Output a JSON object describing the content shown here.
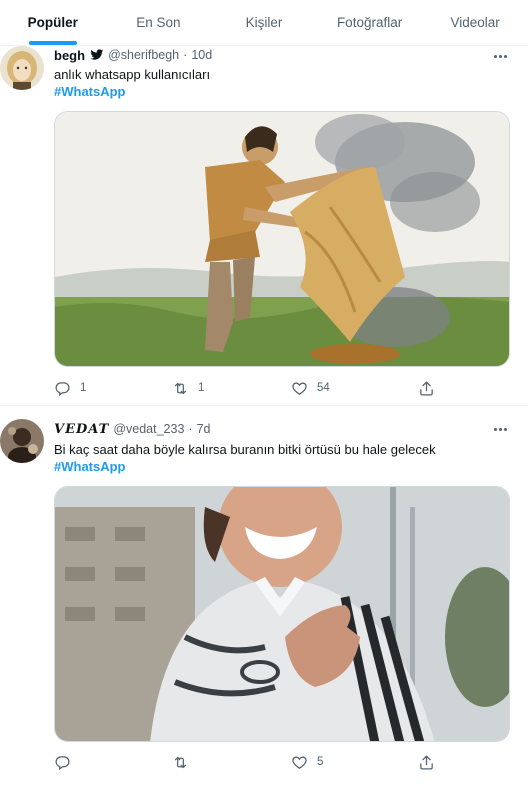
{
  "tabs": [
    {
      "label": "Popüler",
      "active": true
    },
    {
      "label": "En Son",
      "active": false
    },
    {
      "label": "Kişiler",
      "active": false
    },
    {
      "label": "Fotoğraflar",
      "active": false
    },
    {
      "label": "Videolar",
      "active": false
    }
  ],
  "tweets": [
    {
      "name": "begh",
      "verified_icon": "twitter-bird-icon",
      "handle": "@sherifbegh",
      "dot": "·",
      "time": "10d",
      "text": "anlık whatsapp kullanıcıları",
      "hashtag": "#WhatsApp",
      "replies": "1",
      "retweets": "1",
      "likes": "54"
    },
    {
      "name": "VEDAT",
      "handle": "@vedat_233",
      "dot": "·",
      "time": "7d",
      "text": "Bi kaç saat daha böyle kalırsa buranın bitki örtüsü bu hale gelecek",
      "hashtag": "#WhatsApp",
      "replies": "",
      "retweets": "",
      "likes": "5"
    }
  ],
  "colors": {
    "accent": "#1d9bf0",
    "text_secondary": "#536471",
    "divider": "#eff3f4"
  }
}
